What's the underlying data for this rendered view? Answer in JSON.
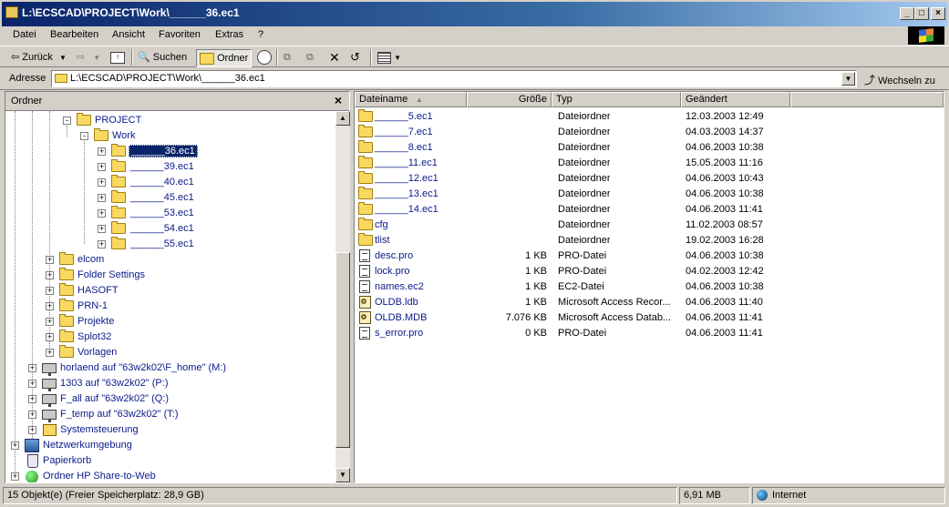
{
  "window": {
    "title": "L:\\ECSCAD\\PROJECT\\Work\\______36.ec1",
    "controls": [
      "_",
      "□",
      "×"
    ]
  },
  "menu": [
    "Datei",
    "Bearbeiten",
    "Ansicht",
    "Favoriten",
    "Extras",
    "?"
  ],
  "toolbar": {
    "back": "Zurück",
    "search": "Suchen",
    "folders": "Ordner"
  },
  "address": {
    "label": "Adresse",
    "value": "L:\\ECSCAD\\PROJECT\\Work\\______36.ec1",
    "go": "Wechseln zu"
  },
  "folderpane": {
    "header": "Ordner",
    "close": "×",
    "tree": [
      {
        "label": "PROJECT",
        "icon": "folder-open-icon",
        "expander": "-"
      },
      {
        "label": "Work",
        "icon": "folder-open-icon",
        "expander": "-"
      },
      {
        "label": "______36.ec1",
        "icon": "folder-open-icon",
        "expander": "+",
        "selected": true
      },
      {
        "label": "______39.ec1",
        "icon": "folder-icon",
        "expander": "+"
      },
      {
        "label": "______40.ec1",
        "icon": "folder-icon",
        "expander": "+"
      },
      {
        "label": "______45.ec1",
        "icon": "folder-icon",
        "expander": "+"
      },
      {
        "label": "______53.ec1",
        "icon": "folder-icon",
        "expander": "+"
      },
      {
        "label": "______54.ec1",
        "icon": "folder-icon",
        "expander": "+"
      },
      {
        "label": "______55.ec1",
        "icon": "folder-icon",
        "expander": "+"
      },
      {
        "label": "elcom",
        "icon": "folder-icon",
        "expander": "+"
      },
      {
        "label": "Folder Settings",
        "icon": "folder-icon",
        "expander": "+"
      },
      {
        "label": "HASOFT",
        "icon": "folder-icon",
        "expander": "+"
      },
      {
        "label": "PRN-1",
        "icon": "folder-icon",
        "expander": "+"
      },
      {
        "label": "Projekte",
        "icon": "folder-icon",
        "expander": "+"
      },
      {
        "label": "Splot32",
        "icon": "folder-icon",
        "expander": "+"
      },
      {
        "label": "Vorlagen",
        "icon": "folder-icon",
        "expander": "+"
      },
      {
        "label": "horlaend auf \"63w2k02\\F_home\" (M:)",
        "icon": "network-drive-icon",
        "expander": "+"
      },
      {
        "label": "1303 auf \"63w2k02\" (P:)",
        "icon": "network-drive-icon",
        "expander": "+"
      },
      {
        "label": "F_all auf \"63w2k02\" (Q:)",
        "icon": "network-drive-icon",
        "expander": "+"
      },
      {
        "label": "F_temp auf \"63w2k02\" (T:)",
        "icon": "network-drive-icon",
        "expander": "+"
      },
      {
        "label": "Systemsteuerung",
        "icon": "control-panel-icon",
        "expander": "+"
      },
      {
        "label": "Netzwerkumgebung",
        "icon": "network-icon",
        "expander": "+"
      },
      {
        "label": "Papierkorb",
        "icon": "recycle-bin-icon",
        "expander": ""
      },
      {
        "label": "Ordner HP Share-to-Web",
        "icon": "web-folder-icon",
        "expander": "+"
      }
    ]
  },
  "filelist": {
    "columns": [
      "Dateiname",
      "Größe",
      "Typ",
      "Geändert"
    ],
    "rows": [
      {
        "name": "______5.ec1",
        "size": "",
        "type": "Dateiordner",
        "modified": "12.03.2003 12:49",
        "icon": "folder-icon"
      },
      {
        "name": "______7.ec1",
        "size": "",
        "type": "Dateiordner",
        "modified": "04.03.2003 14:37",
        "icon": "folder-icon"
      },
      {
        "name": "______8.ec1",
        "size": "",
        "type": "Dateiordner",
        "modified": "04.06.2003 10:38",
        "icon": "folder-icon"
      },
      {
        "name": "______11.ec1",
        "size": "",
        "type": "Dateiordner",
        "modified": "15.05.2003 11:16",
        "icon": "folder-icon"
      },
      {
        "name": "______12.ec1",
        "size": "",
        "type": "Dateiordner",
        "modified": "04.06.2003 10:43",
        "icon": "folder-icon"
      },
      {
        "name": "______13.ec1",
        "size": "",
        "type": "Dateiordner",
        "modified": "04.06.2003 10:38",
        "icon": "folder-icon"
      },
      {
        "name": "______14.ec1",
        "size": "",
        "type": "Dateiordner",
        "modified": "04.06.2003 11:41",
        "icon": "folder-icon"
      },
      {
        "name": "cfg",
        "size": "",
        "type": "Dateiordner",
        "modified": "11.02.2003 08:57",
        "icon": "folder-icon"
      },
      {
        "name": "tlist",
        "size": "",
        "type": "Dateiordner",
        "modified": "19.02.2003 16:28",
        "icon": "folder-icon"
      },
      {
        "name": "desc.pro",
        "size": "1 KB",
        "type": "PRO-Datei",
        "modified": "04.06.2003 10:38",
        "icon": "document-icon"
      },
      {
        "name": "lock.pro",
        "size": "1 KB",
        "type": "PRO-Datei",
        "modified": "04.02.2003 12:42",
        "icon": "document-icon"
      },
      {
        "name": "names.ec2",
        "size": "1 KB",
        "type": "EC2-Datei",
        "modified": "04.06.2003 10:38",
        "icon": "document-icon"
      },
      {
        "name": "OLDB.ldb",
        "size": "1 KB",
        "type": "Microsoft Access Recor...",
        "modified": "04.06.2003 11:40",
        "icon": "access-lock-icon"
      },
      {
        "name": "OLDB.MDB",
        "size": "7.076 KB",
        "type": "Microsoft Access Datab...",
        "modified": "04.06.2003 11:41",
        "icon": "access-db-icon"
      },
      {
        "name": "s_error.pro",
        "size": "0 KB",
        "type": "PRO-Datei",
        "modified": "04.06.2003 11:41",
        "icon": "document-icon"
      }
    ]
  },
  "status": {
    "objects": "15 Objekt(e)  (Freier Speicherplatz: 28,9 GB)",
    "size": "6,91 MB",
    "zone": "Internet"
  }
}
